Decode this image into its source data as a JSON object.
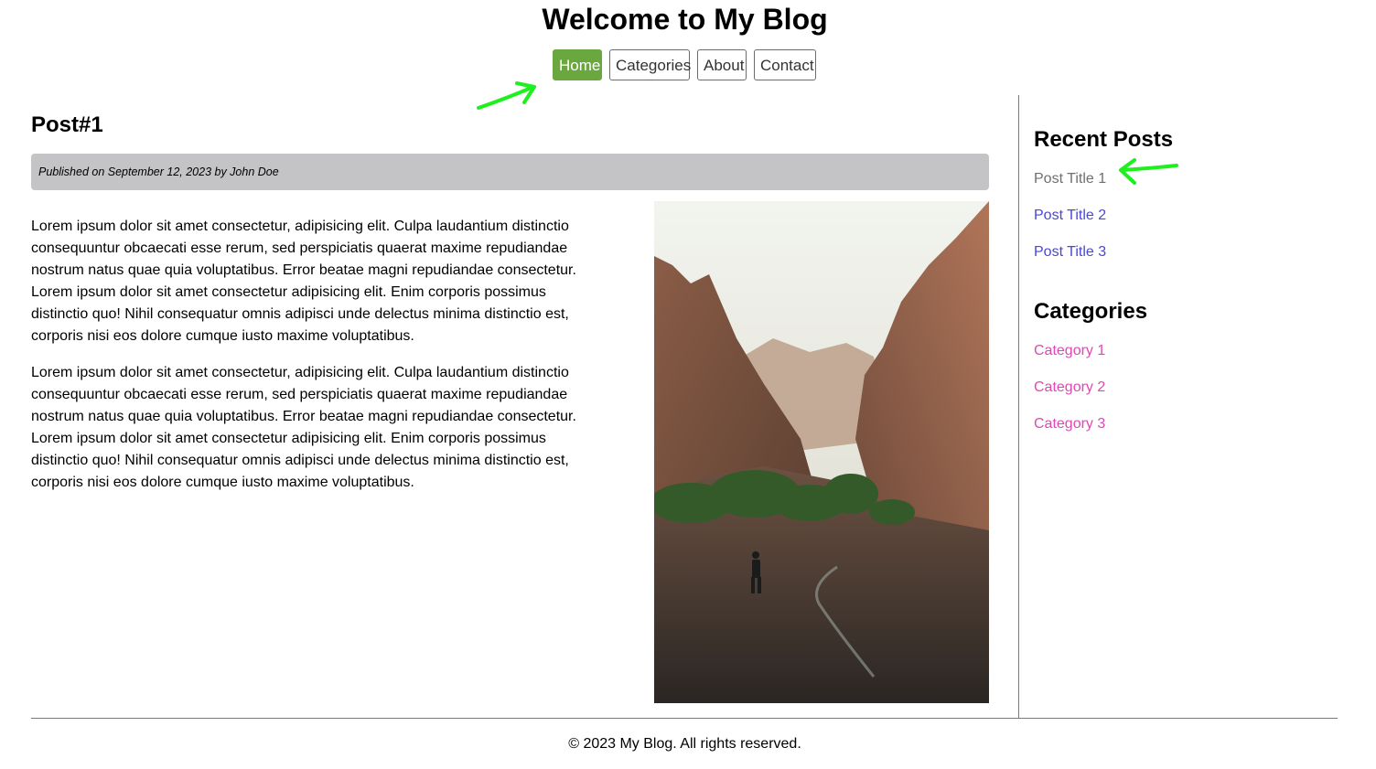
{
  "header": {
    "title": "Welcome to My Blog"
  },
  "nav": {
    "items": [
      {
        "label": "Home",
        "active": true
      },
      {
        "label": "Categories",
        "active": false
      },
      {
        "label": "About",
        "active": false
      },
      {
        "label": "Contact",
        "active": false
      }
    ]
  },
  "post": {
    "title": "Post#1",
    "meta": "Published on September 12, 2023 by John Doe",
    "paragraphs": [
      "Lorem ipsum dolor sit amet consectetur, adipisicing elit. Culpa laudantium distinctio consequuntur obcaecati esse rerum, sed perspiciatis quaerat maxime repudiandae nostrum natus quae quia voluptatibus. Error beatae magni repudiandae consectetur. Lorem ipsum dolor sit amet consectetur adipisicing elit. Enim corporis possimus distinctio quo! Nihil consequatur omnis adipisci unde delectus minima distinctio est, corporis nisi eos dolore cumque iusto maxime voluptatibus.",
      "Lorem ipsum dolor sit amet consectetur, adipisicing elit. Culpa laudantium distinctio consequuntur obcaecati esse rerum, sed perspiciatis quaerat maxime repudiandae nostrum natus quae quia voluptatibus. Error beatae magni repudiandae consectetur. Lorem ipsum dolor sit amet consectetur adipisicing elit. Enim corporis possimus distinctio quo! Nihil consequatur omnis adipisci unde delectus minima distinctio est, corporis nisi eos dolore cumque iusto maxime voluptatibus."
    ]
  },
  "sidebar": {
    "recent_heading": "Recent Posts",
    "recent_posts": [
      "Post Title 1",
      "Post Title 2",
      "Post Title 3"
    ],
    "categories_heading": "Categories",
    "categories": [
      "Category 1",
      "Category 2",
      "Category 3"
    ]
  },
  "footer": {
    "text": "© 2023 My Blog. All rights reserved."
  },
  "colors": {
    "nav_active": "#6aa83f",
    "meta_bar": "#c4c3c5",
    "recent_link": "#4a47d8",
    "recent_link_visited": "#6f6f6f",
    "category_link": "#e047b6",
    "annotation_arrow": "#1ef01e"
  }
}
